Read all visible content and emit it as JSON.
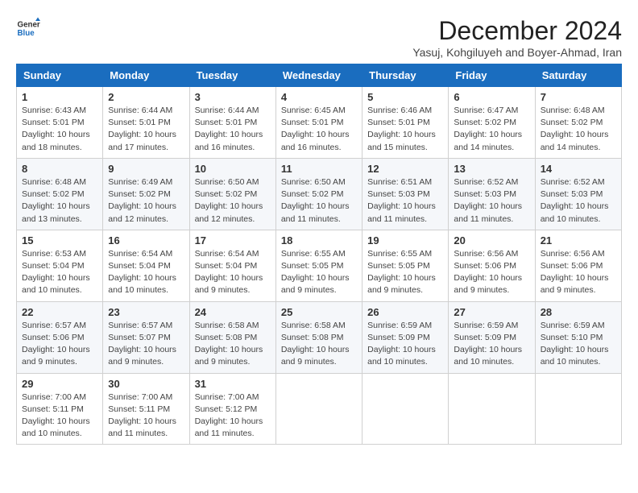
{
  "logo": {
    "line1": "General",
    "line2": "Blue"
  },
  "title": "December 2024",
  "location": "Yasuj, Kohgiluyeh and Boyer-Ahmad, Iran",
  "weekdays": [
    "Sunday",
    "Monday",
    "Tuesday",
    "Wednesday",
    "Thursday",
    "Friday",
    "Saturday"
  ],
  "weeks": [
    [
      {
        "day": 1,
        "sunrise": "6:43 AM",
        "sunset": "5:01 PM",
        "daylight": "10 hours and 18 minutes."
      },
      {
        "day": 2,
        "sunrise": "6:44 AM",
        "sunset": "5:01 PM",
        "daylight": "10 hours and 17 minutes."
      },
      {
        "day": 3,
        "sunrise": "6:44 AM",
        "sunset": "5:01 PM",
        "daylight": "10 hours and 16 minutes."
      },
      {
        "day": 4,
        "sunrise": "6:45 AM",
        "sunset": "5:01 PM",
        "daylight": "10 hours and 16 minutes."
      },
      {
        "day": 5,
        "sunrise": "6:46 AM",
        "sunset": "5:01 PM",
        "daylight": "10 hours and 15 minutes."
      },
      {
        "day": 6,
        "sunrise": "6:47 AM",
        "sunset": "5:02 PM",
        "daylight": "10 hours and 14 minutes."
      },
      {
        "day": 7,
        "sunrise": "6:48 AM",
        "sunset": "5:02 PM",
        "daylight": "10 hours and 14 minutes."
      }
    ],
    [
      {
        "day": 8,
        "sunrise": "6:48 AM",
        "sunset": "5:02 PM",
        "daylight": "10 hours and 13 minutes."
      },
      {
        "day": 9,
        "sunrise": "6:49 AM",
        "sunset": "5:02 PM",
        "daylight": "10 hours and 12 minutes."
      },
      {
        "day": 10,
        "sunrise": "6:50 AM",
        "sunset": "5:02 PM",
        "daylight": "10 hours and 12 minutes."
      },
      {
        "day": 11,
        "sunrise": "6:50 AM",
        "sunset": "5:02 PM",
        "daylight": "10 hours and 11 minutes."
      },
      {
        "day": 12,
        "sunrise": "6:51 AM",
        "sunset": "5:03 PM",
        "daylight": "10 hours and 11 minutes."
      },
      {
        "day": 13,
        "sunrise": "6:52 AM",
        "sunset": "5:03 PM",
        "daylight": "10 hours and 11 minutes."
      },
      {
        "day": 14,
        "sunrise": "6:52 AM",
        "sunset": "5:03 PM",
        "daylight": "10 hours and 10 minutes."
      }
    ],
    [
      {
        "day": 15,
        "sunrise": "6:53 AM",
        "sunset": "5:04 PM",
        "daylight": "10 hours and 10 minutes."
      },
      {
        "day": 16,
        "sunrise": "6:54 AM",
        "sunset": "5:04 PM",
        "daylight": "10 hours and 10 minutes."
      },
      {
        "day": 17,
        "sunrise": "6:54 AM",
        "sunset": "5:04 PM",
        "daylight": "10 hours and 9 minutes."
      },
      {
        "day": 18,
        "sunrise": "6:55 AM",
        "sunset": "5:05 PM",
        "daylight": "10 hours and 9 minutes."
      },
      {
        "day": 19,
        "sunrise": "6:55 AM",
        "sunset": "5:05 PM",
        "daylight": "10 hours and 9 minutes."
      },
      {
        "day": 20,
        "sunrise": "6:56 AM",
        "sunset": "5:06 PM",
        "daylight": "10 hours and 9 minutes."
      },
      {
        "day": 21,
        "sunrise": "6:56 AM",
        "sunset": "5:06 PM",
        "daylight": "10 hours and 9 minutes."
      }
    ],
    [
      {
        "day": 22,
        "sunrise": "6:57 AM",
        "sunset": "5:06 PM",
        "daylight": "10 hours and 9 minutes."
      },
      {
        "day": 23,
        "sunrise": "6:57 AM",
        "sunset": "5:07 PM",
        "daylight": "10 hours and 9 minutes."
      },
      {
        "day": 24,
        "sunrise": "6:58 AM",
        "sunset": "5:08 PM",
        "daylight": "10 hours and 9 minutes."
      },
      {
        "day": 25,
        "sunrise": "6:58 AM",
        "sunset": "5:08 PM",
        "daylight": "10 hours and 9 minutes."
      },
      {
        "day": 26,
        "sunrise": "6:59 AM",
        "sunset": "5:09 PM",
        "daylight": "10 hours and 10 minutes."
      },
      {
        "day": 27,
        "sunrise": "6:59 AM",
        "sunset": "5:09 PM",
        "daylight": "10 hours and 10 minutes."
      },
      {
        "day": 28,
        "sunrise": "6:59 AM",
        "sunset": "5:10 PM",
        "daylight": "10 hours and 10 minutes."
      }
    ],
    [
      {
        "day": 29,
        "sunrise": "7:00 AM",
        "sunset": "5:11 PM",
        "daylight": "10 hours and 10 minutes."
      },
      {
        "day": 30,
        "sunrise": "7:00 AM",
        "sunset": "5:11 PM",
        "daylight": "10 hours and 11 minutes."
      },
      {
        "day": 31,
        "sunrise": "7:00 AM",
        "sunset": "5:12 PM",
        "daylight": "10 hours and 11 minutes."
      },
      null,
      null,
      null,
      null
    ]
  ]
}
